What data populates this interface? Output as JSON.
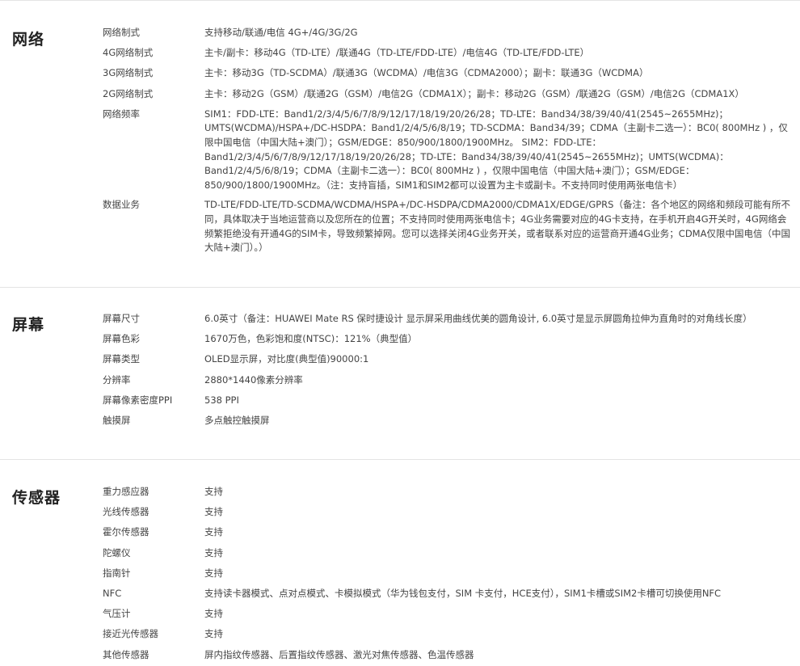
{
  "network": {
    "title": "网络",
    "rows": [
      {
        "label": "网络制式",
        "value": "支持移动/联通/电信 4G+/4G/3G/2G"
      },
      {
        "label": "4G网络制式",
        "value": "主卡/副卡：移动4G（TD-LTE）/联通4G（TD-LTE/FDD-LTE）/电信4G（TD-LTE/FDD-LTE）"
      },
      {
        "label": "3G网络制式",
        "value": "主卡：移动3G（TD-SCDMA）/联通3G（WCDMA）/电信3G（CDMA2000）；副卡：联通3G（WCDMA）"
      },
      {
        "label": "2G网络制式",
        "value": "主卡：移动2G（GSM）/联通2G（GSM）/电信2G（CDMA1X）；副卡：移动2G（GSM）/联通2G（GSM）/电信2G（CDMA1X）"
      },
      {
        "label": "网络频率",
        "value": "SIM1：FDD-LTE：Band1/2/3/4/5/6/7/8/9/12/17/18/19/20/26/28；TD-LTE：Band34/38/39/40/41(2545~2655MHz)；UMTS(WCDMA)/HSPA+/DC-HSDPA：Band1/2/4/5/6/8/19；TD-SCDMA：Band34/39；CDMA（主副卡二选一）：BC0( 800MHz ) ，仅限中国电信（中国大陆+澳门）；GSM/EDGE：850/900/1800/1900MHz。 SIM2：FDD-LTE：Band1/2/3/4/5/6/7/8/9/12/17/18/19/20/26/28；TD-LTE：Band34/38/39/40/41(2545~2655MHz)；UMTS(WCDMA)：Band1/2/4/5/6/8/19；CDMA（主副卡二选一）：BC0( 800MHz ) ，仅限中国电信（中国大陆+澳门）；GSM/EDGE：850/900/1800/1900MHz。（注：支持盲插，SIM1和SIM2都可以设置为主卡或副卡。不支持同时使用两张电信卡）"
      },
      {
        "label": "数据业务",
        "value": "TD-LTE/FDD-LTE/TD-SCDMA/WCDMA/HSPA+/DC-HSDPA/CDMA2000/CDMA1X/EDGE/GPRS（备注：各个地区的网络和频段可能有所不同，具体取决于当地运营商以及您所在的位置；不支持同时使用两张电信卡；4G业务需要对应的4G卡支持，在手机开启4G开关时，4G网络会频繁拒绝没有开通4G的SIM卡，导致频繁掉网。您可以选择关闭4G业务开关，或者联系对应的运营商开通4G业务；CDMA仅限中国电信（中国大陆+澳门）。）"
      }
    ]
  },
  "screen": {
    "title": "屏幕",
    "rows": [
      {
        "label": "屏幕尺寸",
        "value": "6.0英寸（备注：HUAWEI Mate RS 保时捷设计 显示屏采用曲线优美的圆角设计, 6.0英寸是显示屏圆角拉伸为直角时的对角线长度）"
      },
      {
        "label": "屏幕色彩",
        "value": "1670万色，色彩饱和度(NTSC)：121%（典型值）"
      },
      {
        "label": "屏幕类型",
        "value": "OLED显示屏，对比度(典型值)90000:1"
      },
      {
        "label": "分辨率",
        "value": "2880*1440像素分辨率"
      },
      {
        "label": "屏幕像素密度PPI",
        "value": "538 PPI"
      },
      {
        "label": "触摸屏",
        "value": "多点触控触摸屏"
      }
    ]
  },
  "sensor": {
    "title": "传感器",
    "rows": [
      {
        "label": "重力感应器",
        "value": "支持"
      },
      {
        "label": "光线传感器",
        "value": "支持"
      },
      {
        "label": "霍尔传感器",
        "value": "支持"
      },
      {
        "label": "陀螺仪",
        "value": "支持"
      },
      {
        "label": "指南针",
        "value": "支持"
      },
      {
        "label": "NFC",
        "value": "支持读卡器模式、点对点模式、卡模拟模式（华为钱包支付，SIM 卡支付，HCE支付），SIM1卡槽或SIM2卡槽可切换使用NFC"
      },
      {
        "label": "气压计",
        "value": "支持"
      },
      {
        "label": "接近光传感器",
        "value": "支持"
      },
      {
        "label": "其他传感器",
        "value": "屏内指纹传感器、后置指纹传感器、激光对焦传感器、色温传感器"
      }
    ]
  }
}
